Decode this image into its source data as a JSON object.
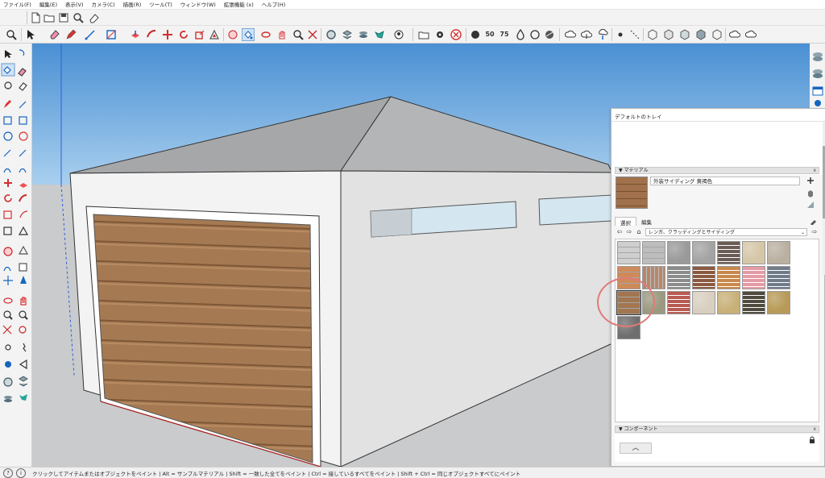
{
  "menu": [
    "ファイル(F)",
    "編集(E)",
    "表示(V)",
    "カメラ(C)",
    "描画(R)",
    "ツール(T)",
    "ウィンドウ(W)",
    "拡張機能 (x)",
    "ヘルプ(H)"
  ],
  "toolbar_row1_icons": [
    "new-file-icon",
    "open-folder-icon",
    "save-icon",
    "search-icon",
    "eraser-icon"
  ],
  "toolbar_row2_icons": [
    "zoom-icon",
    "select-icon",
    "eraser-icon",
    "pencil-icon",
    "line-icon",
    "rectangle-icon",
    "push-pull-icon",
    "follow-me-icon",
    "move-icon",
    "rotate-icon",
    "scale-icon",
    "offset-icon",
    "tape-icon",
    "paint-bucket-icon",
    "orbit-icon",
    "pan-icon",
    "zoom-window-icon",
    "zoom-extents-icon",
    "component-icon",
    "layers-icon",
    "styles-icon",
    "camera-icon",
    "folder-icon",
    "settings-icon",
    "close-circle-icon",
    "position-icon",
    "50-icon",
    "75-icon",
    "solid-icon",
    "hidden-icon",
    "xray-icon",
    "cloud-icon",
    "upload-icon",
    "download-icon",
    "dot-icon",
    "dashed-icon",
    "cube-icon",
    "shadow-icon",
    "fog-icon",
    "sandbox-icon",
    "cloud2-icon",
    "cloud3-icon"
  ],
  "status": {
    "text": "クリックしてアイテムまたはオブジェクトをペイント | Alt = サンプルマテリアル | Shift = 一致した全てをペイント | Ctrl = 接しているすべてをペイント | Shift + Ctrl = 同じオブジェクトすべてにペイント",
    "icon1": "?",
    "icon2": "i"
  },
  "tray": {
    "title": "デフォルトのトレイ",
    "materials_section": "マテリアル",
    "material_name": "外装サイディング 黄褐色",
    "tab_select": "選択",
    "tab_edit": "編集",
    "collection": "レンガ、クラッディングとサイディング",
    "components_section": "コンポーネント",
    "close_x": "x"
  },
  "colors": {
    "sky": "#5b9cd6",
    "ground": "#c9cbcd",
    "roof_left": "#a8a9ab",
    "roof_right": "#b3b4b6",
    "wall_front": "#f2f2f2",
    "wall_side": "#e3e3e3",
    "door": "#a27650",
    "highlight_circle": "#e07a76"
  },
  "swatches": [
    {
      "name": "siding-light-gray",
      "color": "#cfcfcf",
      "pattern": "lines"
    },
    {
      "name": "siding-gray",
      "color": "#bdbdbd",
      "pattern": "lines"
    },
    {
      "name": "stone-gray",
      "color": "#9a9a9a",
      "pattern": "rough"
    },
    {
      "name": "concrete-gray",
      "color": "#a3a3a3",
      "pattern": "rough"
    },
    {
      "name": "brick-dark",
      "color": "#6a5b55",
      "pattern": "brick"
    },
    {
      "name": "sandstone",
      "color": "#d6c6a8",
      "pattern": "rough"
    },
    {
      "name": "stone-beige",
      "color": "#b9b0a0",
      "pattern": "rough"
    },
    {
      "name": "wood-orange",
      "color": "#cf8a5a",
      "pattern": "lines"
    },
    {
      "name": "wood-planks",
      "color": "#b8876a",
      "pattern": "vlines"
    },
    {
      "name": "stone-tiles",
      "color": "#8b8b8b",
      "pattern": "brick"
    },
    {
      "name": "brick-red-brown",
      "color": "#8a5a40",
      "pattern": "brick"
    },
    {
      "name": "brick-orange",
      "color": "#c8884c",
      "pattern": "brick"
    },
    {
      "name": "brick-pink",
      "color": "#e59ba6",
      "pattern": "brick"
    },
    {
      "name": "brick-blue-gray",
      "color": "#707b8a",
      "pattern": "brick"
    },
    {
      "name": "exterior-siding-tan",
      "color": "#a27650",
      "pattern": "lines",
      "selected": true
    },
    {
      "name": "pebble-stone",
      "color": "#9a9a80",
      "pattern": "rough"
    },
    {
      "name": "brick-red",
      "color": "#b85a52",
      "pattern": "brick"
    },
    {
      "name": "tile-cream",
      "color": "#d8cfc0",
      "pattern": "rough"
    },
    {
      "name": "stone-yellow",
      "color": "#c8b078",
      "pattern": "rough"
    },
    {
      "name": "brick-black",
      "color": "#4e4a3e",
      "pattern": "brick"
    },
    {
      "name": "stone-ochre",
      "color": "#b89a58",
      "pattern": "rough"
    },
    {
      "name": "granite-gray",
      "color": "#6e6e6e",
      "pattern": "rough"
    }
  ]
}
